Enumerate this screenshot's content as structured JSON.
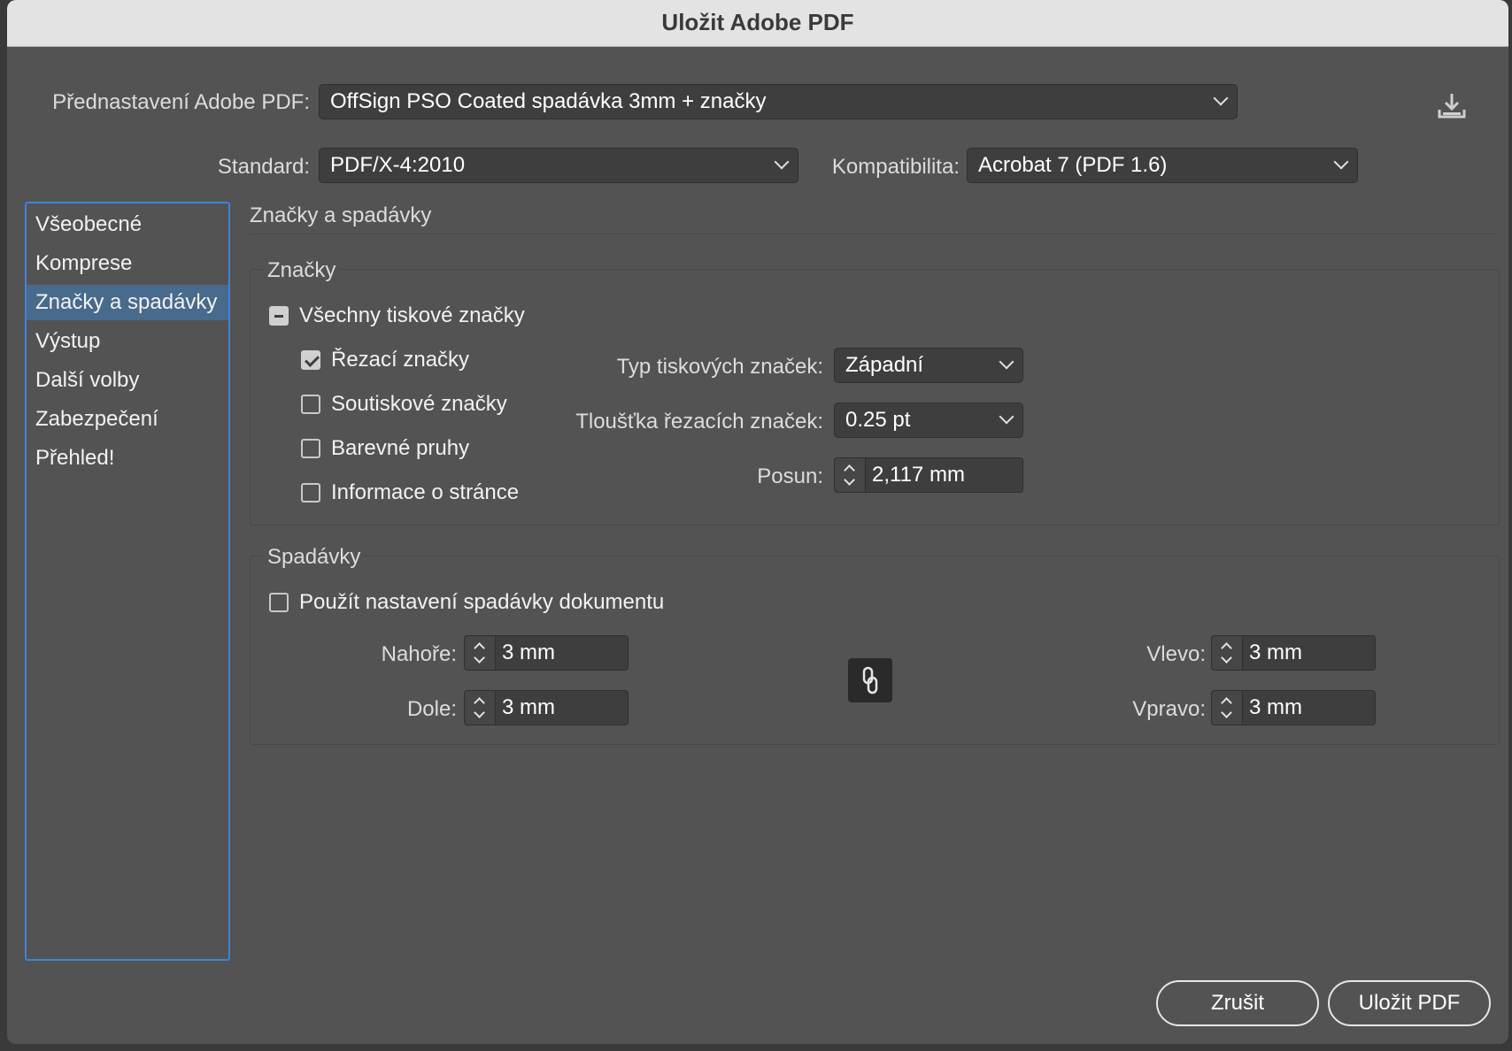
{
  "window": {
    "title": "Uložit Adobe PDF"
  },
  "preset": {
    "label": "Přednastavení Adobe PDF:",
    "value": "OffSign PSO Coated spadávka 3mm + značky"
  },
  "save_preset_icon": "download-icon",
  "standard": {
    "label": "Standard:",
    "value": "PDF/X-4:2010"
  },
  "compatibility": {
    "label": "Kompatibilita:",
    "value": "Acrobat 7 (PDF 1.6)"
  },
  "sidebar": {
    "items": [
      {
        "label": "Všeobecné",
        "active": false
      },
      {
        "label": "Komprese",
        "active": false
      },
      {
        "label": "Značky a spadávky",
        "active": true
      },
      {
        "label": "Výstup",
        "active": false
      },
      {
        "label": "Další volby",
        "active": false
      },
      {
        "label": "Zabezpečení",
        "active": false
      },
      {
        "label": "Přehled!",
        "active": false
      }
    ]
  },
  "section": {
    "title": "Značky a spadávky"
  },
  "marks": {
    "title": "Značky",
    "all_marks": {
      "label": "Všechny tiskové značky",
      "state": "mixed"
    },
    "crop_marks": {
      "label": "Řezací značky",
      "checked": true
    },
    "registration_marks": {
      "label": "Soutiskové značky",
      "checked": false
    },
    "color_bars": {
      "label": "Barevné pruhy",
      "checked": false
    },
    "page_info": {
      "label": "Informace o stránce",
      "checked": false
    },
    "type": {
      "label": "Typ tiskových značek:",
      "value": "Západní"
    },
    "weight": {
      "label": "Tloušťka řezacích značek:",
      "value": "0.25 pt"
    },
    "offset": {
      "label": "Posun:",
      "value": "2,117 mm"
    }
  },
  "bleeds": {
    "title": "Spadávky",
    "use_document": {
      "label": "Použít nastavení spadávky dokumentu",
      "checked": false
    },
    "top": {
      "label": "Nahoře:",
      "value": "3 mm"
    },
    "bottom": {
      "label": "Dole:",
      "value": "3 mm"
    },
    "left": {
      "label": "Vlevo:",
      "value": "3 mm"
    },
    "right": {
      "label": "Vpravo:",
      "value": "3 mm"
    },
    "link_icon": "link-icon"
  },
  "buttons": {
    "cancel": "Zrušit",
    "save": "Uložit PDF"
  },
  "colors": {
    "accent": "#3b85d8",
    "selected": "#486a8c",
    "background": "#535353"
  }
}
